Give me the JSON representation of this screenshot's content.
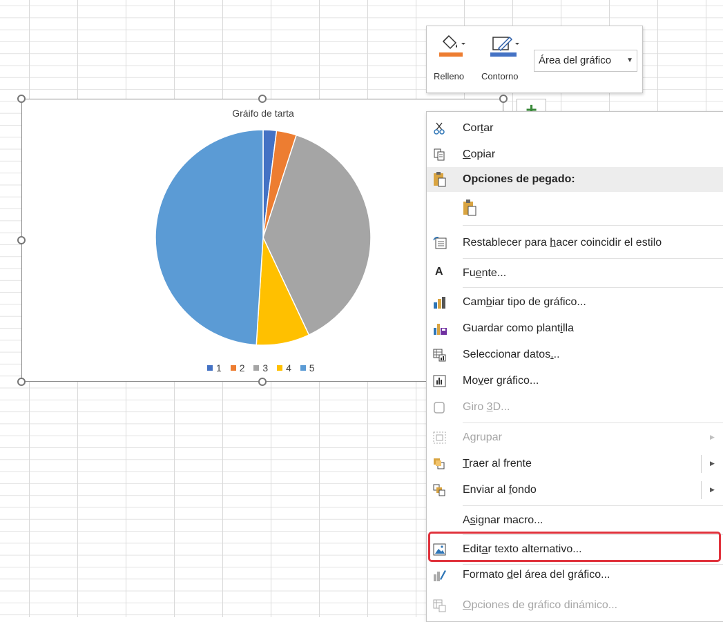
{
  "chart": {
    "title": "Gráifo de tarta",
    "legend": [
      "1",
      "2",
      "3",
      "4",
      "5"
    ]
  },
  "chart_data": {
    "type": "pie",
    "title": "Gráifo de tarta",
    "categories": [
      "1",
      "2",
      "3",
      "4",
      "5"
    ],
    "values": [
      2,
      3,
      38,
      8,
      49
    ],
    "colors": [
      "#4472c4",
      "#ed7d31",
      "#a5a5a5",
      "#ffc000",
      "#5b9bd5"
    ],
    "legend_position": "bottom"
  },
  "format_toolbar": {
    "fill_label": "Relleno",
    "outline_label": "Contorno",
    "element_select": "Área del gráfico",
    "fill_color": "#ed7d31",
    "outline_color": "#4472c4"
  },
  "context_menu": {
    "items": [
      {
        "pre": "Cor",
        "ul": "t",
        "post": "ar"
      },
      {
        "pre": "",
        "ul": "C",
        "post": "opiar"
      },
      {
        "pre": "Opciones de pegado:",
        "ul": "",
        "post": ""
      },
      {
        "pre": "Restablecer para ",
        "ul": "h",
        "post": "acer coincidir el estilo"
      },
      {
        "pre": "Fu",
        "ul": "e",
        "post": "nte..."
      },
      {
        "pre": "Cam",
        "ul": "b",
        "post": "iar tipo de gráfico..."
      },
      {
        "pre": "Guardar como plant",
        "ul": "i",
        "post": "lla"
      },
      {
        "pre": "Seleccionar datos",
        "ul": ".",
        "post": ".."
      },
      {
        "pre": "Mo",
        "ul": "v",
        "post": "er gráfico..."
      },
      {
        "pre": "Giro ",
        "ul": "3",
        "post": "D..."
      },
      {
        "pre": "A",
        "ul": "g",
        "post": "rupar"
      },
      {
        "pre": "",
        "ul": "T",
        "post": "raer al frente"
      },
      {
        "pre": "Enviar al ",
        "ul": "f",
        "post": "ondo"
      },
      {
        "pre": "A",
        "ul": "s",
        "post": "ignar macro..."
      },
      {
        "pre": "Edit",
        "ul": "a",
        "post": "r texto alternativo..."
      },
      {
        "pre": "Formato ",
        "ul": "d",
        "post": "el área del gráfico..."
      },
      {
        "pre": "",
        "ul": "O",
        "post": "pciones de gráfico dinámico..."
      }
    ]
  }
}
